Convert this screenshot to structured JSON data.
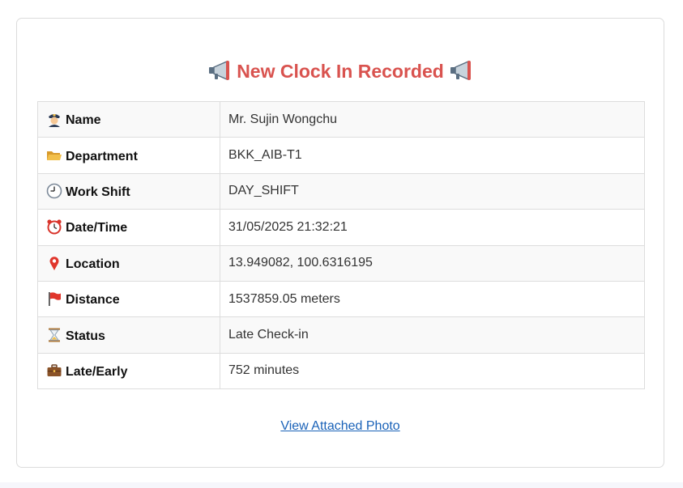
{
  "header": {
    "title": "New Clock In Recorded",
    "left_icon": "megaphone-icon",
    "right_icon": "megaphone-icon",
    "title_color": "#d9534f"
  },
  "rows": [
    {
      "label": "Name",
      "value": "Mr. Sujin Wongchu",
      "icon": "police-officer-icon"
    },
    {
      "label": "Department",
      "value": "BKK_AIB-T1",
      "icon": "open-folder-icon"
    },
    {
      "label": "Work Shift",
      "value": "DAY_SHIFT",
      "icon": "clock-icon"
    },
    {
      "label": "Date/Time",
      "value": "31/05/2025 21:32:21",
      "icon": "alarm-clock-icon"
    },
    {
      "label": "Location",
      "value": "13.949082, 100.6316195",
      "icon": "map-pin-icon"
    },
    {
      "label": "Distance",
      "value": "1537859.05 meters",
      "icon": "red-flag-icon"
    },
    {
      "label": "Status",
      "value": "Late Check-in",
      "icon": "hourglass-icon"
    },
    {
      "label": "Late/Early",
      "value": "752 minutes",
      "icon": "briefcase-icon"
    }
  ],
  "footer": {
    "link_label": "View Attached Photo",
    "link_color": "#1a62b8"
  }
}
